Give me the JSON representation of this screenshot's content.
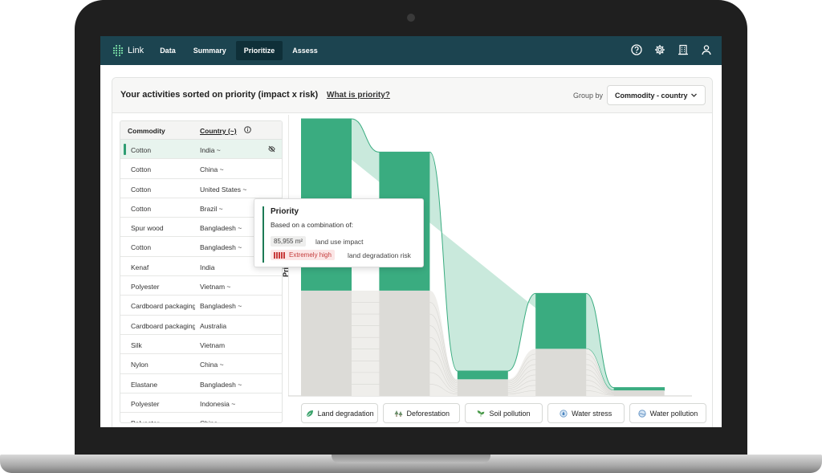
{
  "nav": {
    "logo_text": "Link",
    "items": [
      "Data",
      "Summary",
      "Prioritize",
      "Assess"
    ],
    "active": "Prioritize"
  },
  "header": {
    "title": "Your activities sorted on priority (impact x risk)",
    "help_link": "What is priority?",
    "group_by_label": "Group by",
    "group_by_value": "Commodity - country"
  },
  "table": {
    "columns": [
      "Commodity",
      "Country (~)"
    ],
    "rows": [
      {
        "commodity": "Cotton",
        "country": "India ~"
      },
      {
        "commodity": "Cotton",
        "country": "China ~"
      },
      {
        "commodity": "Cotton",
        "country": "United States ~"
      },
      {
        "commodity": "Cotton",
        "country": "Brazil ~"
      },
      {
        "commodity": "Spur wood",
        "country": "Bangladesh ~"
      },
      {
        "commodity": "Cotton",
        "country": "Bangladesh ~"
      },
      {
        "commodity": "Kenaf",
        "country": "India"
      },
      {
        "commodity": "Polyester",
        "country": "Vietnam ~"
      },
      {
        "commodity": "Cardboard packaging",
        "country": "Bangladesh ~"
      },
      {
        "commodity": "Cardboard packaging",
        "country": "Australia"
      },
      {
        "commodity": "Silk",
        "country": "Vietnam"
      },
      {
        "commodity": "Nylon",
        "country": "China ~"
      },
      {
        "commodity": "Elastane",
        "country": "Bangladesh ~"
      },
      {
        "commodity": "Polyester",
        "country": "Indonesia ~"
      },
      {
        "commodity": "Polyester",
        "country": "China"
      }
    ]
  },
  "chart": {
    "y_label": "Priority",
    "categories": [
      "Land degradation",
      "Deforestation",
      "Soil pollution",
      "Water stress",
      "Water pollution"
    ],
    "category_icons": [
      "leaf-icon",
      "trees-icon",
      "sprout-icon",
      "water-drop-icon",
      "globe-water-icon"
    ],
    "colors": {
      "highlight": "#3aac80",
      "highlight_light": "#c9e9dc",
      "rest": "#dcdbd7"
    }
  },
  "chart_data": {
    "type": "area",
    "title": "",
    "ylabel": "Priority",
    "categories": [
      "Land degradation",
      "Deforestation",
      "Soil pollution",
      "Water stress",
      "Water pollution"
    ],
    "series": [
      {
        "values": [
          0.62,
          0.5,
          0.03,
          0.2,
          0.01
        ]
      },
      {
        "values": [
          0.38,
          0.38,
          0.06,
          0.17,
          0.02
        ]
      }
    ],
    "ylim": [
      0,
      1
    ]
  },
  "tooltip": {
    "title": "Priority",
    "subtitle": "Based on a combination of:",
    "value": "85,955 m²",
    "value_label": "land use impact",
    "risk": "Extremely high",
    "risk_label": "land degradation risk"
  }
}
